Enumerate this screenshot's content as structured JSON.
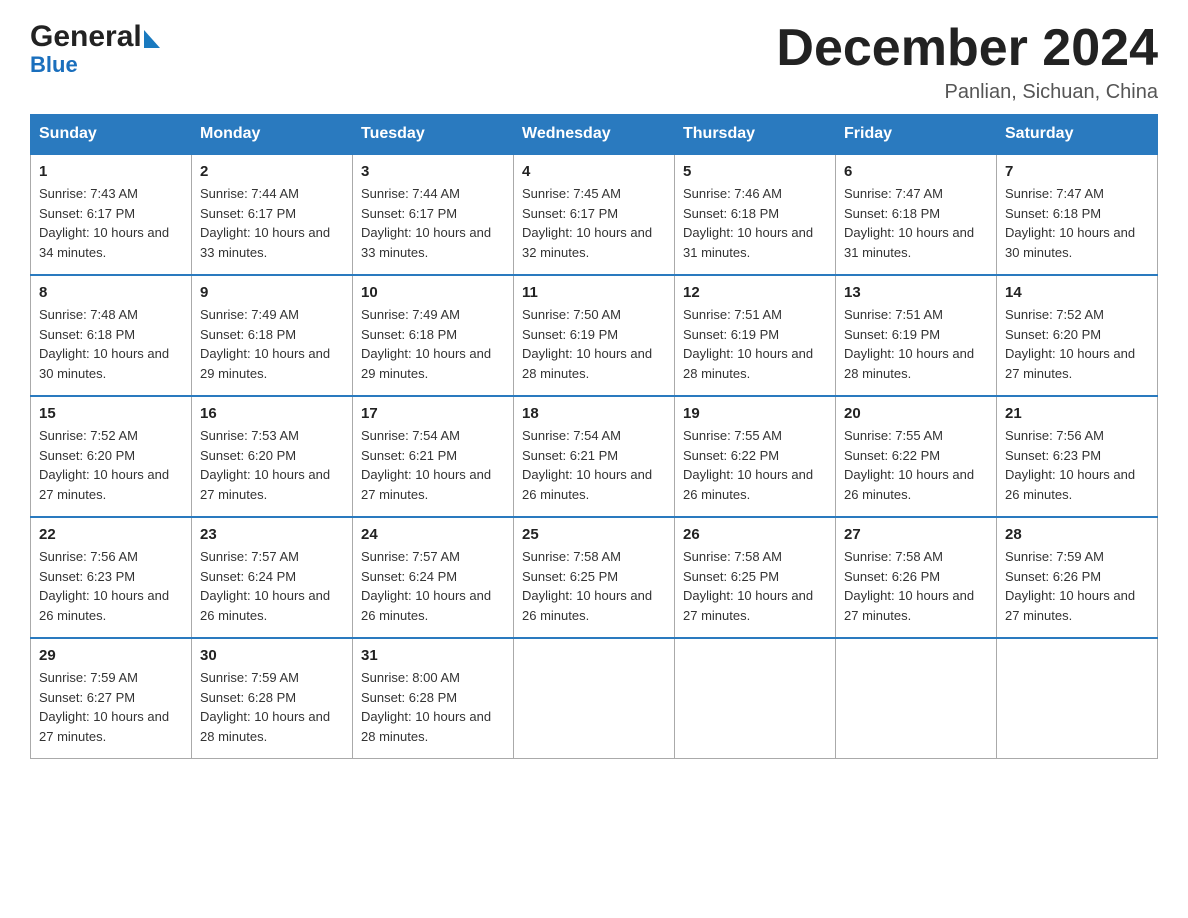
{
  "header": {
    "logo_general": "General",
    "logo_blue": "Blue",
    "month_title": "December 2024",
    "subtitle": "Panlian, Sichuan, China"
  },
  "days_of_week": [
    "Sunday",
    "Monday",
    "Tuesday",
    "Wednesday",
    "Thursday",
    "Friday",
    "Saturday"
  ],
  "weeks": [
    [
      {
        "day": "1",
        "sunrise": "7:43 AM",
        "sunset": "6:17 PM",
        "daylight": "10 hours and 34 minutes."
      },
      {
        "day": "2",
        "sunrise": "7:44 AM",
        "sunset": "6:17 PM",
        "daylight": "10 hours and 33 minutes."
      },
      {
        "day": "3",
        "sunrise": "7:44 AM",
        "sunset": "6:17 PM",
        "daylight": "10 hours and 33 minutes."
      },
      {
        "day": "4",
        "sunrise": "7:45 AM",
        "sunset": "6:17 PM",
        "daylight": "10 hours and 32 minutes."
      },
      {
        "day": "5",
        "sunrise": "7:46 AM",
        "sunset": "6:18 PM",
        "daylight": "10 hours and 31 minutes."
      },
      {
        "day": "6",
        "sunrise": "7:47 AM",
        "sunset": "6:18 PM",
        "daylight": "10 hours and 31 minutes."
      },
      {
        "day": "7",
        "sunrise": "7:47 AM",
        "sunset": "6:18 PM",
        "daylight": "10 hours and 30 minutes."
      }
    ],
    [
      {
        "day": "8",
        "sunrise": "7:48 AM",
        "sunset": "6:18 PM",
        "daylight": "10 hours and 30 minutes."
      },
      {
        "day": "9",
        "sunrise": "7:49 AM",
        "sunset": "6:18 PM",
        "daylight": "10 hours and 29 minutes."
      },
      {
        "day": "10",
        "sunrise": "7:49 AM",
        "sunset": "6:18 PM",
        "daylight": "10 hours and 29 minutes."
      },
      {
        "day": "11",
        "sunrise": "7:50 AM",
        "sunset": "6:19 PM",
        "daylight": "10 hours and 28 minutes."
      },
      {
        "day": "12",
        "sunrise": "7:51 AM",
        "sunset": "6:19 PM",
        "daylight": "10 hours and 28 minutes."
      },
      {
        "day": "13",
        "sunrise": "7:51 AM",
        "sunset": "6:19 PM",
        "daylight": "10 hours and 28 minutes."
      },
      {
        "day": "14",
        "sunrise": "7:52 AM",
        "sunset": "6:20 PM",
        "daylight": "10 hours and 27 minutes."
      }
    ],
    [
      {
        "day": "15",
        "sunrise": "7:52 AM",
        "sunset": "6:20 PM",
        "daylight": "10 hours and 27 minutes."
      },
      {
        "day": "16",
        "sunrise": "7:53 AM",
        "sunset": "6:20 PM",
        "daylight": "10 hours and 27 minutes."
      },
      {
        "day": "17",
        "sunrise": "7:54 AM",
        "sunset": "6:21 PM",
        "daylight": "10 hours and 27 minutes."
      },
      {
        "day": "18",
        "sunrise": "7:54 AM",
        "sunset": "6:21 PM",
        "daylight": "10 hours and 26 minutes."
      },
      {
        "day": "19",
        "sunrise": "7:55 AM",
        "sunset": "6:22 PM",
        "daylight": "10 hours and 26 minutes."
      },
      {
        "day": "20",
        "sunrise": "7:55 AM",
        "sunset": "6:22 PM",
        "daylight": "10 hours and 26 minutes."
      },
      {
        "day": "21",
        "sunrise": "7:56 AM",
        "sunset": "6:23 PM",
        "daylight": "10 hours and 26 minutes."
      }
    ],
    [
      {
        "day": "22",
        "sunrise": "7:56 AM",
        "sunset": "6:23 PM",
        "daylight": "10 hours and 26 minutes."
      },
      {
        "day": "23",
        "sunrise": "7:57 AM",
        "sunset": "6:24 PM",
        "daylight": "10 hours and 26 minutes."
      },
      {
        "day": "24",
        "sunrise": "7:57 AM",
        "sunset": "6:24 PM",
        "daylight": "10 hours and 26 minutes."
      },
      {
        "day": "25",
        "sunrise": "7:58 AM",
        "sunset": "6:25 PM",
        "daylight": "10 hours and 26 minutes."
      },
      {
        "day": "26",
        "sunrise": "7:58 AM",
        "sunset": "6:25 PM",
        "daylight": "10 hours and 27 minutes."
      },
      {
        "day": "27",
        "sunrise": "7:58 AM",
        "sunset": "6:26 PM",
        "daylight": "10 hours and 27 minutes."
      },
      {
        "day": "28",
        "sunrise": "7:59 AM",
        "sunset": "6:26 PM",
        "daylight": "10 hours and 27 minutes."
      }
    ],
    [
      {
        "day": "29",
        "sunrise": "7:59 AM",
        "sunset": "6:27 PM",
        "daylight": "10 hours and 27 minutes."
      },
      {
        "day": "30",
        "sunrise": "7:59 AM",
        "sunset": "6:28 PM",
        "daylight": "10 hours and 28 minutes."
      },
      {
        "day": "31",
        "sunrise": "8:00 AM",
        "sunset": "6:28 PM",
        "daylight": "10 hours and 28 minutes."
      },
      null,
      null,
      null,
      null
    ]
  ]
}
